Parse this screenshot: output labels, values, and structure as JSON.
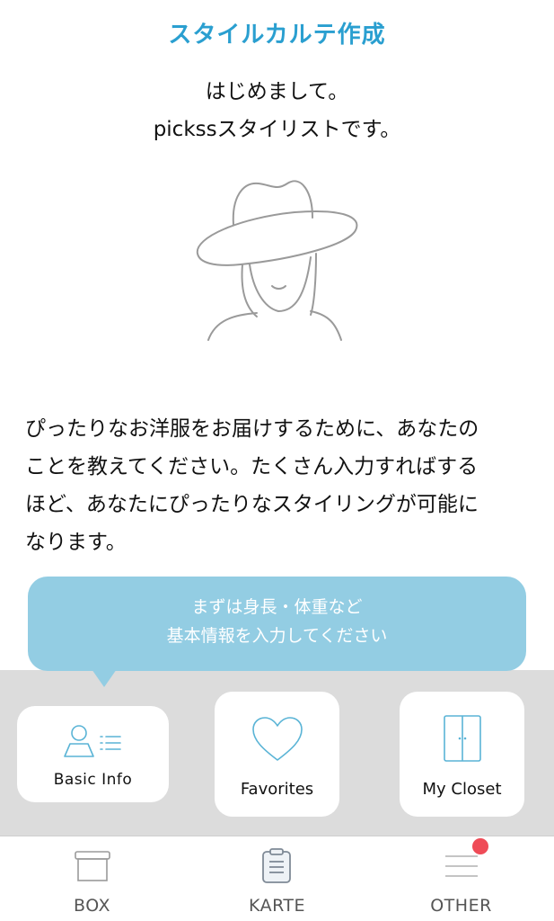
{
  "header": {
    "title": "スタイルカルテ作成",
    "greeting_line1": "はじめまして。",
    "greeting_line2": "pickssスタイリストです。"
  },
  "description": {
    "lines": [
      "ぴったりなお洋服をお届けするために、あなたの",
      "ことを教えてください。たくさん入力すればする",
      "ほど、あなたにぴったりなスタイリングが可能に",
      "なります。"
    ]
  },
  "tooltip": {
    "line1": "まずは身長・体重など",
    "line2": "基本情報を入力してください"
  },
  "cards": {
    "basic_info": "Basic Info",
    "favorites": "Favorites",
    "my_closet": "My Closet"
  },
  "tabbar": {
    "box": "BOX",
    "karte": "KARTE",
    "other": "OTHER"
  },
  "colors": {
    "title": "#2a9fd0",
    "tooltip_bg": "#93cde3",
    "icon_accent": "#5ab4d6",
    "badge": "#ef4b57",
    "panel_bg": "#dcdcdc"
  }
}
